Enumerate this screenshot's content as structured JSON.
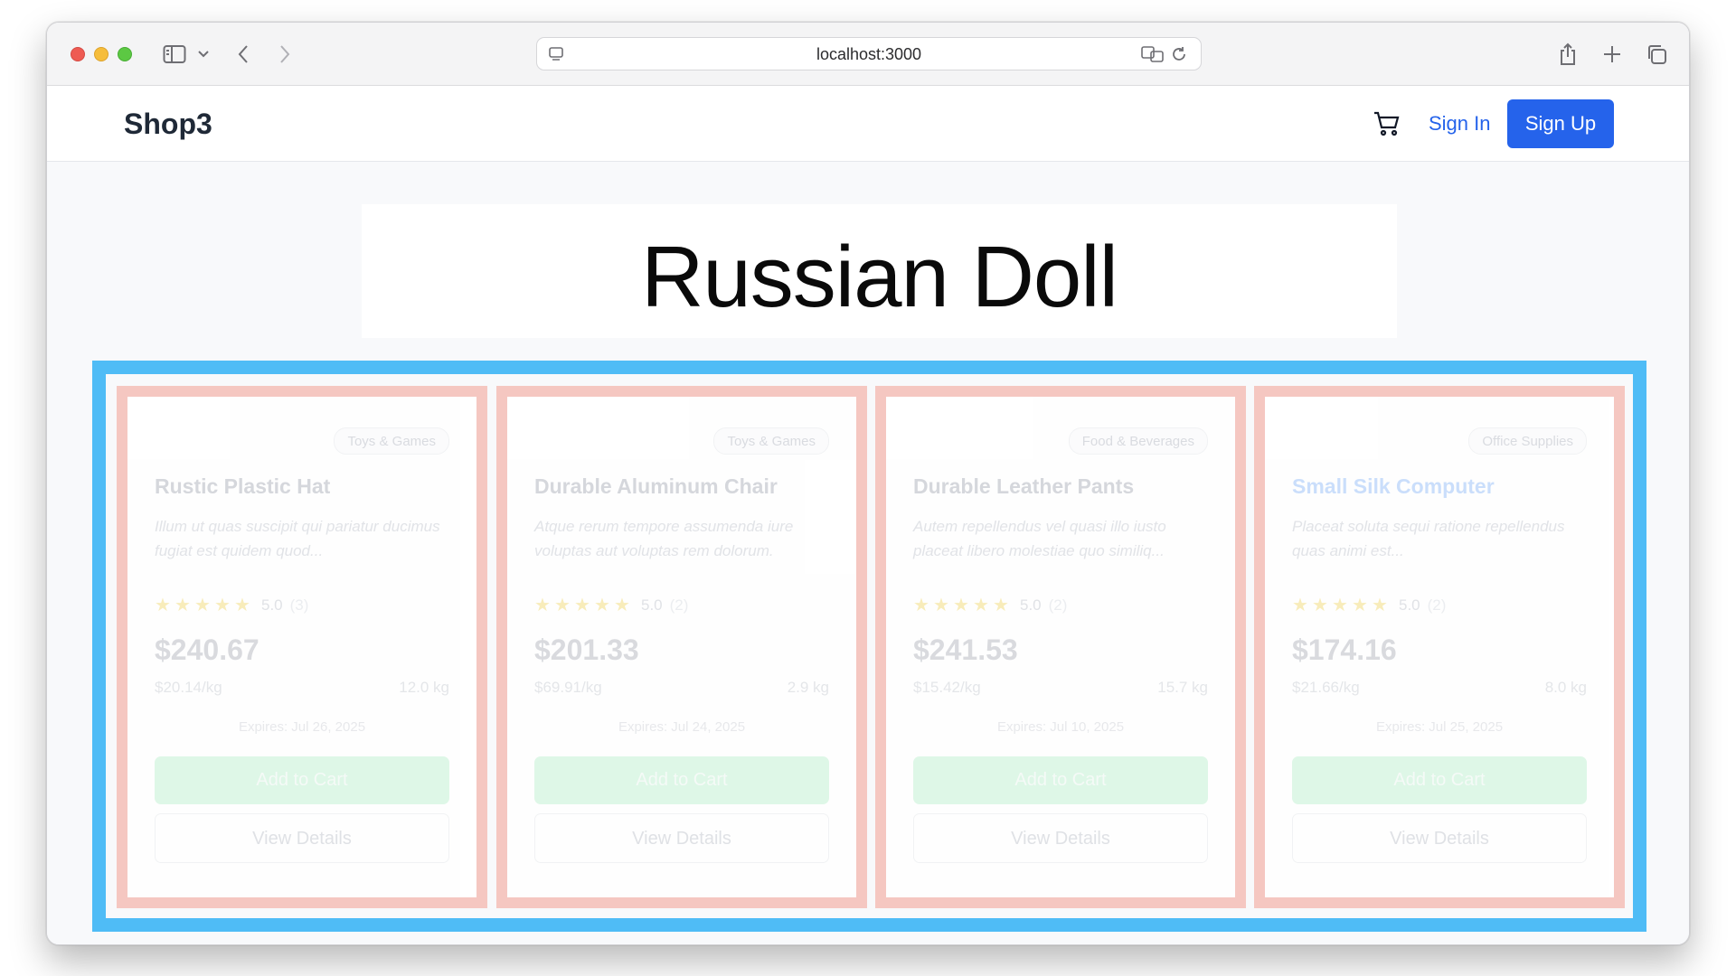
{
  "browser": {
    "url": "localhost:3000"
  },
  "header": {
    "brand": "Shop3",
    "sign_in": "Sign In",
    "sign_up": "Sign Up"
  },
  "hero": {
    "title": "Russian Doll"
  },
  "colors": {
    "primary": "#2563eb",
    "grid_outline": "#4fbcf6",
    "card_outline": "#f5c7c1"
  },
  "products": [
    {
      "category": "Toys & Games",
      "name": "Rustic Plastic Hat",
      "description": "Illum ut quas suscipit qui pariatur ducimus fugiat est quidem quod...",
      "rating": "5.0",
      "reviews": "(3)",
      "price": "$240.67",
      "unit_price": "$20.14/kg",
      "weight": "12.0 kg",
      "expires": "Expires: Jul 26, 2025",
      "add_to_cart": "Add to Cart",
      "view_details": "View Details"
    },
    {
      "category": "Toys & Games",
      "name": "Durable Aluminum Chair",
      "description": "Atque rerum tempore assumenda iure voluptas aut voluptas rem dolorum.",
      "rating": "5.0",
      "reviews": "(2)",
      "price": "$201.33",
      "unit_price": "$69.91/kg",
      "weight": "2.9 kg",
      "expires": "Expires: Jul 24, 2025",
      "add_to_cart": "Add to Cart",
      "view_details": "View Details"
    },
    {
      "category": "Food & Beverages",
      "name": "Durable Leather Pants",
      "description": "Autem repellendus vel quasi illo iusto placeat libero molestiae quo similiq...",
      "rating": "5.0",
      "reviews": "(2)",
      "price": "$241.53",
      "unit_price": "$15.42/kg",
      "weight": "15.7 kg",
      "expires": "Expires: Jul 10, 2025",
      "add_to_cart": "Add to Cart",
      "view_details": "View Details"
    },
    {
      "category": "Office Supplies",
      "name": "Small Silk Computer",
      "description": "Placeat soluta sequi ratione repellendus quas animi est...",
      "rating": "5.0",
      "reviews": "(2)",
      "price": "$174.16",
      "unit_price": "$21.66/kg",
      "weight": "8.0 kg",
      "expires": "Expires: Jul 25, 2025",
      "add_to_cart": "Add to Cart",
      "view_details": "View Details"
    }
  ]
}
